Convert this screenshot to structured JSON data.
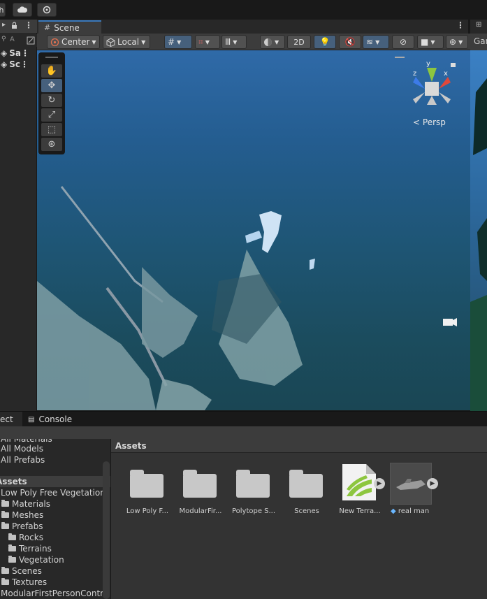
{
  "topbar": {
    "btn1_label": "h",
    "cloud_icon": "cloud-icon",
    "settings_icon": "gear-icon"
  },
  "hierarchy": {
    "search_placeholder": "A",
    "rows": [
      {
        "label": "Sa"
      },
      {
        "label": "Sc"
      }
    ]
  },
  "scene": {
    "tab_label": "Scene",
    "toolbar": {
      "pivot_label": "Center",
      "space_label": "Local",
      "mode_2d_label": "2D"
    },
    "persp_label": "Persp",
    "gizmo_axes": {
      "x": "x",
      "y": "y",
      "z": "z"
    }
  },
  "game": {
    "tab_label": "Gar"
  },
  "bottom": {
    "tabs": [
      {
        "label": "ect"
      },
      {
        "label": "Console"
      }
    ],
    "left_tree": [
      {
        "label": "All Materials",
        "indent": 0
      },
      {
        "label": "All Models",
        "indent": 0
      },
      {
        "label": "All Prefabs",
        "indent": 0
      },
      {
        "label": "Assets",
        "indent": 0,
        "selected": true,
        "bold": true
      },
      {
        "label": "Low Poly Free Vegetation",
        "indent": 0
      },
      {
        "label": "Materials",
        "indent": 1
      },
      {
        "label": "Meshes",
        "indent": 1
      },
      {
        "label": "Prefabs",
        "indent": 1
      },
      {
        "label": "Rocks",
        "indent": 2
      },
      {
        "label": "Terrains",
        "indent": 2
      },
      {
        "label": "Vegetation",
        "indent": 2
      },
      {
        "label": "Scenes",
        "indent": 1
      },
      {
        "label": "Textures",
        "indent": 1
      },
      {
        "label": "ModularFirstPersonContro",
        "indent": 0
      }
    ],
    "breadcrumb": "Assets",
    "assets": [
      {
        "name": "Low Poly F...",
        "kind": "folder"
      },
      {
        "name": "ModularFir...",
        "kind": "folder"
      },
      {
        "name": "Polytope S...",
        "kind": "folder"
      },
      {
        "name": "Scenes",
        "kind": "folder"
      },
      {
        "name": "New Terra...",
        "kind": "terrain"
      },
      {
        "name": "real man",
        "kind": "model"
      }
    ]
  }
}
